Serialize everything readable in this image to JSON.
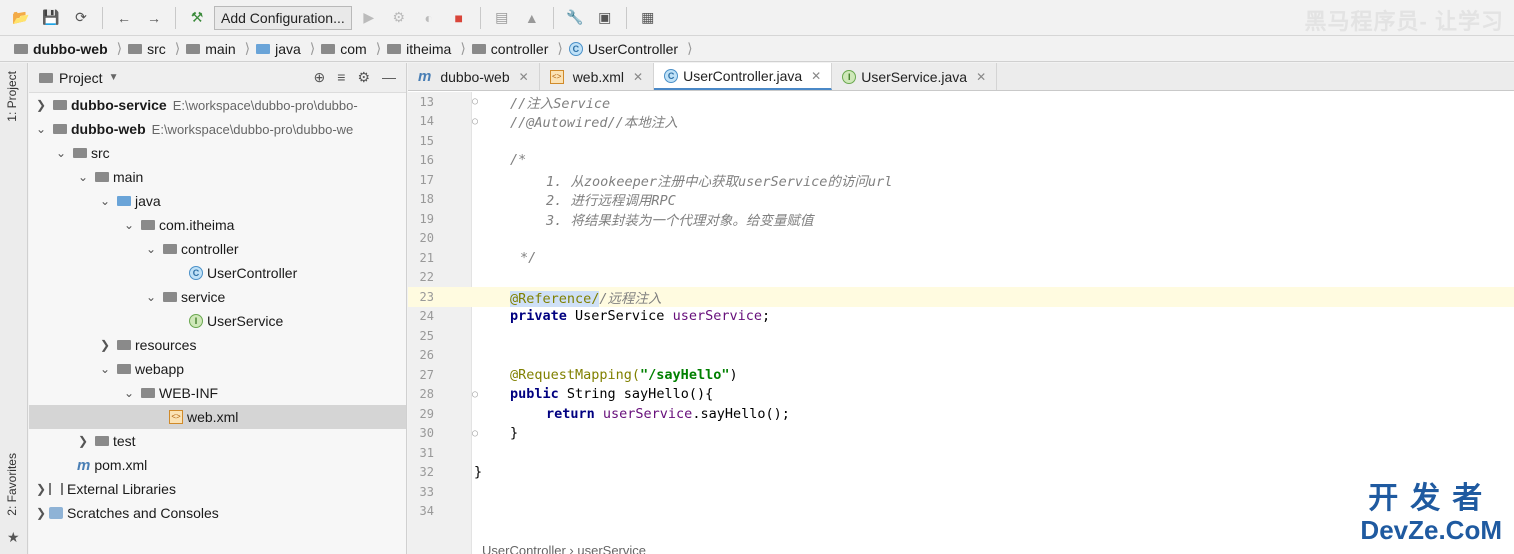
{
  "toolbar": {
    "run_config": "Add Configuration...",
    "watermark": "黑马程序员- 让学习"
  },
  "breadcrumb": [
    "dubbo-web",
    "src",
    "main",
    "java",
    "com",
    "itheima",
    "controller",
    "UserController"
  ],
  "sidebar": {
    "project_label": "1: Project",
    "favorites_label": "2: Favorites"
  },
  "project_panel": {
    "title": "Project",
    "tree": [
      {
        "label": "dubbo-service",
        "path": "E:\\workspace\\dubbo-pro\\dubbo-",
        "bold": true
      },
      {
        "label": "dubbo-web",
        "path": "E:\\workspace\\dubbo-pro\\dubbo-we",
        "bold": true
      },
      {
        "label": "src"
      },
      {
        "label": "main"
      },
      {
        "label": "java"
      },
      {
        "label": "com.itheima"
      },
      {
        "label": "controller"
      },
      {
        "label": "UserController"
      },
      {
        "label": "service"
      },
      {
        "label": "UserService"
      },
      {
        "label": "resources"
      },
      {
        "label": "webapp"
      },
      {
        "label": "WEB-INF"
      },
      {
        "label": "web.xml"
      },
      {
        "label": "test"
      },
      {
        "label": "pom.xml"
      },
      {
        "label": "External Libraries"
      },
      {
        "label": "Scratches and Consoles"
      }
    ]
  },
  "editor": {
    "tabs": [
      {
        "label": "dubbo-web"
      },
      {
        "label": "web.xml"
      },
      {
        "label": "UserController.java"
      },
      {
        "label": "UserService.java"
      }
    ],
    "line_numbers": [
      "13",
      "14",
      "15",
      "16",
      "17",
      "18",
      "19",
      "20",
      "21",
      "22",
      "23",
      "24",
      "25",
      "26",
      "27",
      "28",
      "29",
      "30",
      "31",
      "32",
      "33",
      "34"
    ],
    "lines": {
      "l13": "//注入Service",
      "l14": "//@Autowired//本地注入",
      "l16": "/*",
      "l17": "1. 从zookeeper注册中心获取userService的访问url",
      "l18": "2. 进行远程调用RPC",
      "l19": "3. 将结果封装为一个代理对象。给变量赋值",
      "l21": "*/",
      "l23_ann": "@Reference/",
      "l23_rest": "/远程注入",
      "l24_kw": "private",
      "l24_type": " UserService ",
      "l24_field": "userService",
      "l24_end": ";",
      "l27_ann": "@RequestMapping(",
      "l27_str": "\"/sayHello\"",
      "l27_end": ")",
      "l28_kw": "public",
      "l28_rest": " String sayHello(){",
      "l29_kw": "return",
      "l29_field": " userService",
      "l29_rest": ".sayHello();",
      "l30": "}",
      "l32": "}"
    },
    "bottom_crumb": "UserController  ›  userService"
  },
  "watermark": {
    "cn": "开发者",
    "en": "DevZe.CoM"
  }
}
